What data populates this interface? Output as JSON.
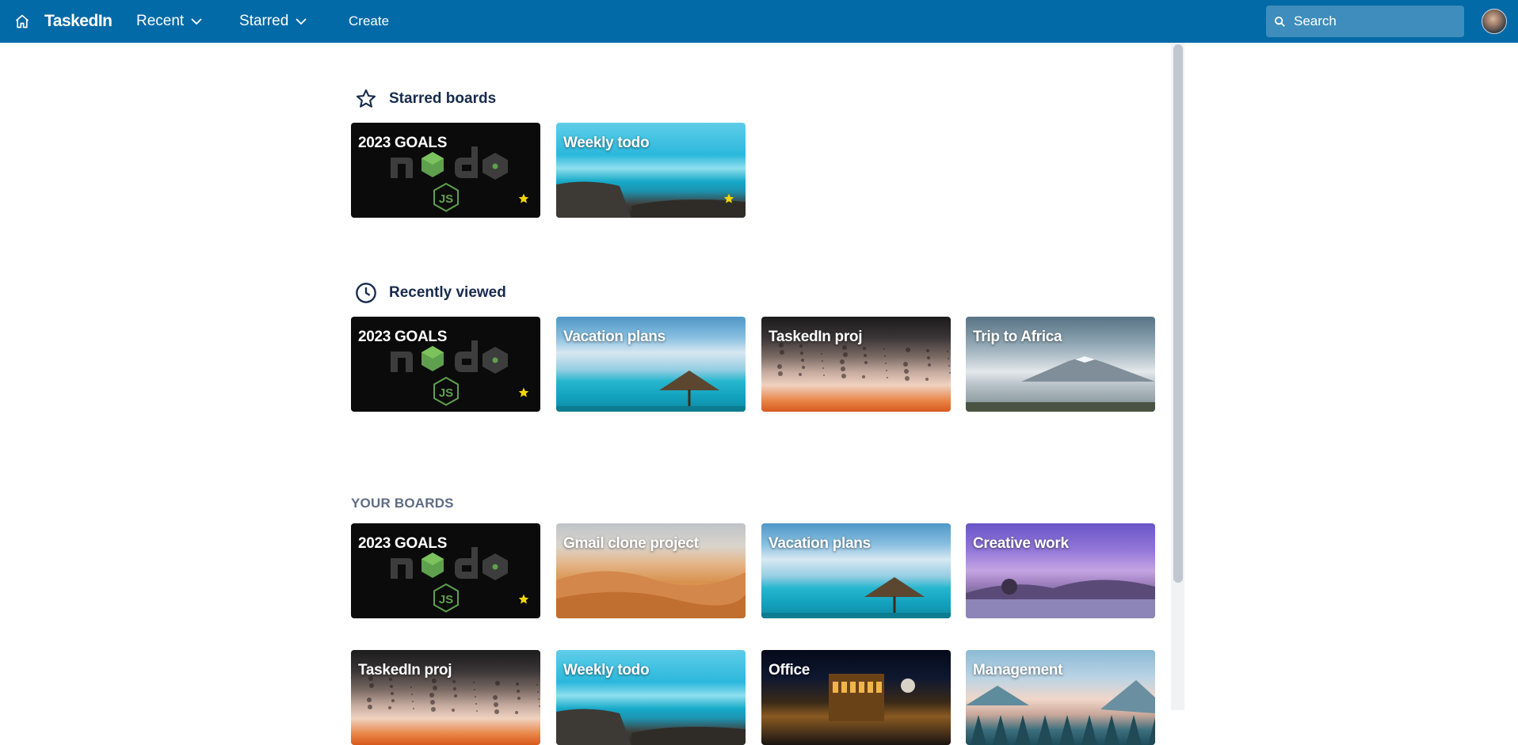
{
  "topbar": {
    "brand": "TaskedIn",
    "recent_label": "Recent",
    "starred_label": "Starred",
    "create_label": "Create",
    "search_placeholder": "Search"
  },
  "colors": {
    "topbar_bg": "#026aa7",
    "star_color": "#f2d600",
    "section_title": "#172b4d",
    "your_boards_title": "#5e6c84"
  },
  "starred": {
    "title": "Starred boards",
    "icon": "star-outline-icon",
    "boards": [
      {
        "title": "2023 GOALS",
        "background": "nodejs-logo",
        "starred": true
      },
      {
        "title": "Weekly todo",
        "background": "ocean-coast",
        "starred": true
      }
    ]
  },
  "recent": {
    "title": "Recently viewed",
    "icon": "clock-icon",
    "boards": [
      {
        "title": "2023 GOALS",
        "background": "nodejs-logo",
        "starred": true
      },
      {
        "title": "Vacation plans",
        "background": "beach-umbrella",
        "starred": false
      },
      {
        "title": "TaskedIn proj",
        "background": "rain-window",
        "starred": false
      },
      {
        "title": "Trip to Africa",
        "background": "kilimanjaro",
        "starred": false
      }
    ]
  },
  "your_boards": {
    "title": "YOUR BOARDS",
    "boards": [
      {
        "title": "2023 GOALS",
        "background": "nodejs-logo",
        "starred": true
      },
      {
        "title": "Gmail clone project",
        "background": "desert-dunes",
        "starred": false
      },
      {
        "title": "Vacation plans",
        "background": "beach-umbrella",
        "starred": false
      },
      {
        "title": "Creative work",
        "background": "purple-lake-tree",
        "starred": false
      },
      {
        "title": "TaskedIn proj",
        "background": "rain-window",
        "starred": false
      },
      {
        "title": "Weekly todo",
        "background": "ocean-coast",
        "starred": false
      },
      {
        "title": "Office",
        "background": "city-night",
        "starred": false
      },
      {
        "title": "Management",
        "background": "pine-mountains",
        "starred": false
      }
    ]
  }
}
